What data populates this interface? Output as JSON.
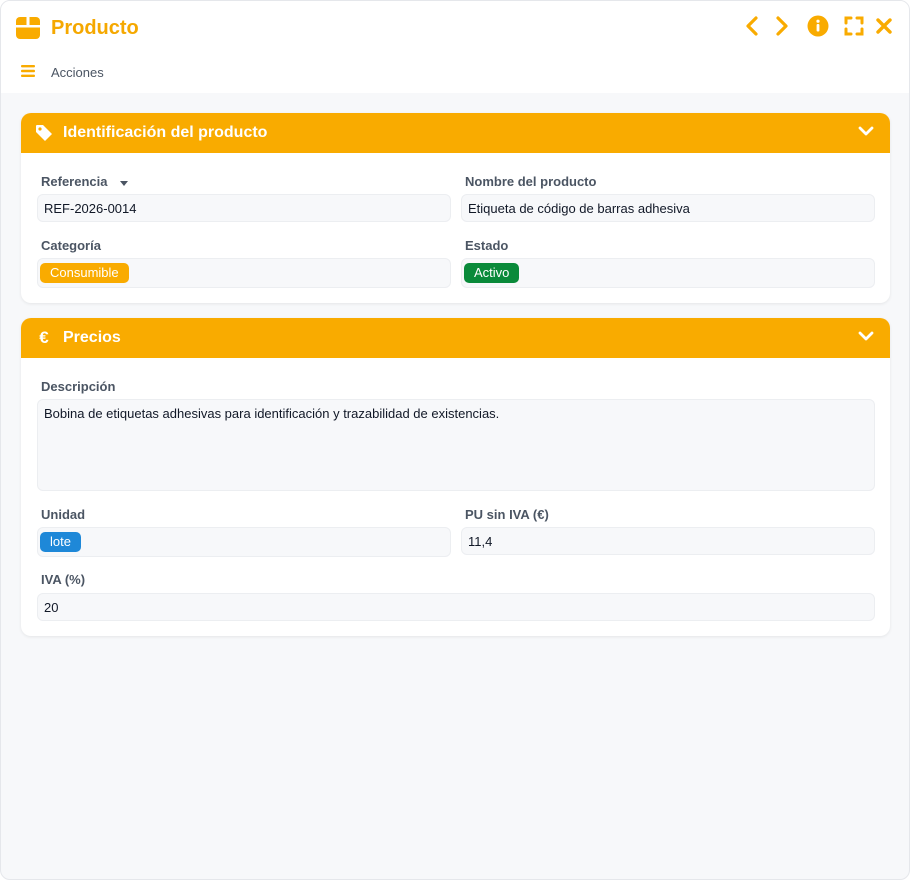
{
  "window": {
    "title": "Producto",
    "title_icon": "box-icon",
    "controls": [
      "chevron-left-icon",
      "chevron-right-icon",
      "info-icon",
      "expand-icon",
      "close-icon"
    ]
  },
  "menu": {
    "label": "Acciones",
    "icon": "hamburger-icon"
  },
  "colors": {
    "accent": "#f9ab00",
    "title": "#f5a800",
    "pill_consumible": "#f9ab00",
    "pill_activo": "#0a8a3a",
    "pill_lote": "#1e88d8"
  },
  "sections": {
    "identificacion": {
      "title": "Identificación del producto",
      "icon": "tag-icon",
      "referencia_label": "Referencia",
      "referencia_value": "REF-2026-0014",
      "nombre_label": "Nombre del producto",
      "nombre_value": "Etiqueta de código de barras adhesiva",
      "categoria_label": "Categoría",
      "categoria_value": "Consumible",
      "estado_label": "Estado",
      "estado_value": "Activo"
    },
    "precios": {
      "title": "Precios",
      "icon": "euro-icon",
      "descripcion_label": "Descripción",
      "descripcion_value": "Bobina de etiquetas adhesivas para identificación y trazabilidad de existencias.",
      "unidad_label": "Unidad",
      "unidad_value": "lote",
      "pu_label": "PU sin IVA (€)",
      "pu_value": "11,4",
      "iva_label": "IVA (%)",
      "iva_value": "20"
    }
  }
}
